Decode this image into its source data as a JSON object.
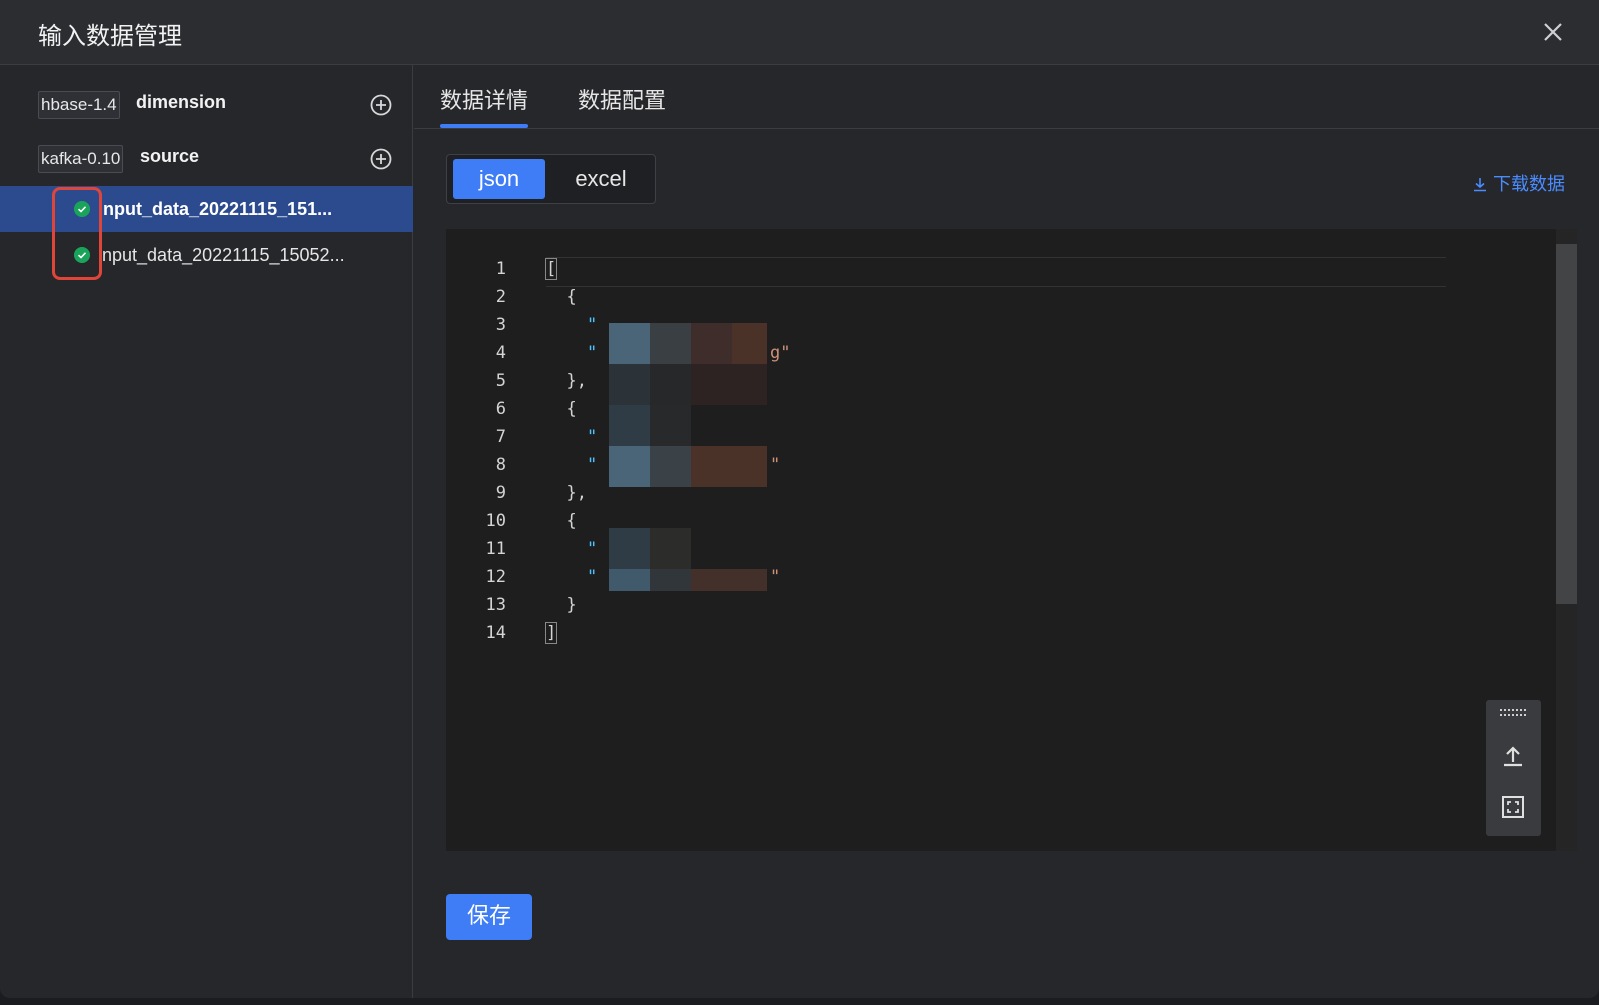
{
  "dialog": {
    "title": "输入数据管理"
  },
  "sidebar": {
    "groups": [
      {
        "tag": "hbase-1.4",
        "name": "dimension"
      },
      {
        "tag": "kafka-0.10",
        "name": "source"
      }
    ],
    "files": [
      {
        "name": "input_data_20221115_151...",
        "selected": true,
        "status": "success"
      },
      {
        "name": "input_data_20221115_15052...",
        "selected": false,
        "status": "success"
      }
    ]
  },
  "tabs": [
    {
      "label": "数据详情",
      "active": true
    },
    {
      "label": "数据配置",
      "active": false
    }
  ],
  "format_toggle": {
    "options": [
      "json",
      "excel"
    ],
    "selected": "json"
  },
  "download_label": "下载数据",
  "editor": {
    "line_numbers": [
      "1",
      "2",
      "3",
      "4",
      "5",
      "6",
      "7",
      "8",
      "9",
      "10",
      "11",
      "12",
      "13",
      "14"
    ],
    "lines": [
      "[",
      "  {",
      "    \"",
      "    \"",
      "  },",
      "  {",
      "    \"",
      "    \"",
      "  },",
      "  {",
      "    \"",
      "    \"",
      "  }",
      "]"
    ],
    "fragments": {
      "line4_tail": "g\"",
      "line8_tail": "\"",
      "line12_tail": "\""
    }
  },
  "save_label": "保存",
  "colors": {
    "accent": "#3f7df6",
    "success": "#1aa35a",
    "highlight": "#e0453a"
  }
}
